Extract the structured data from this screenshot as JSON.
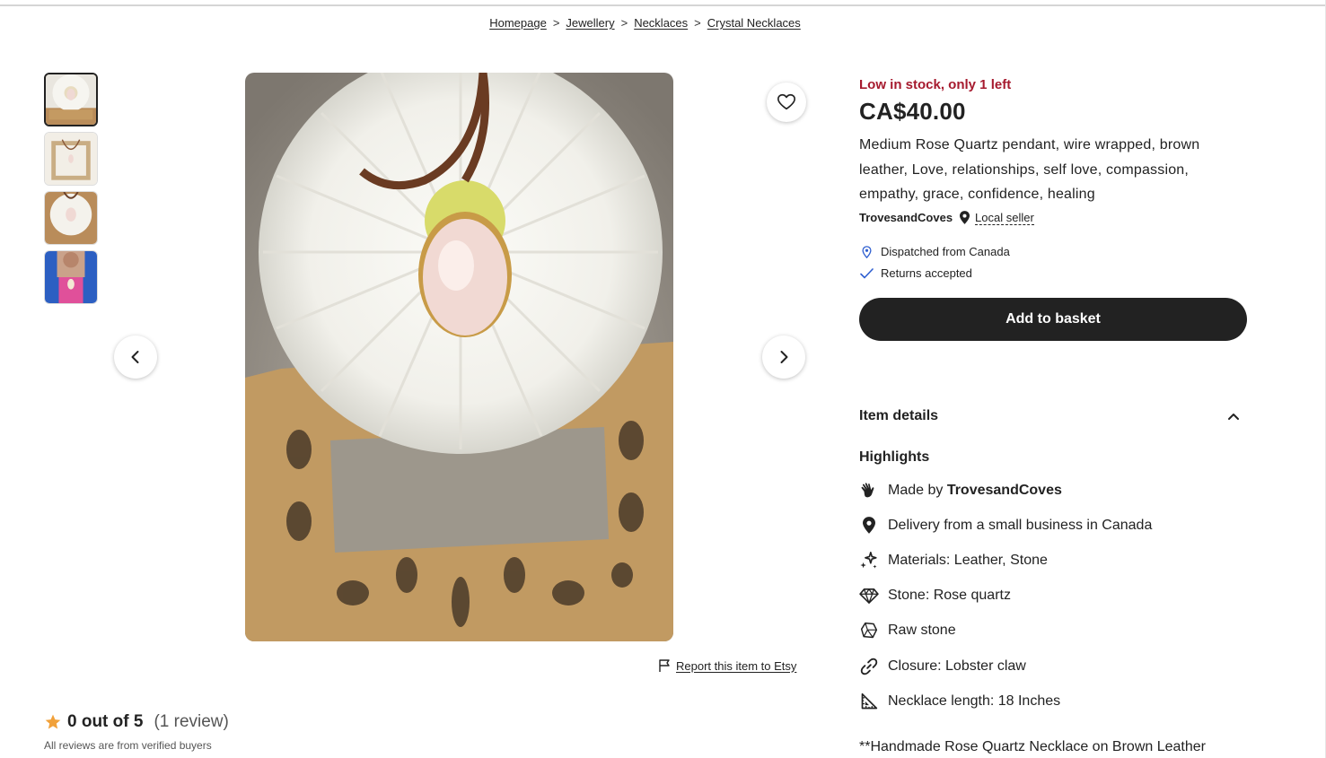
{
  "breadcrumb": {
    "items": [
      "Homepage",
      "Jewellery",
      "Necklaces",
      "Crystal Necklaces"
    ],
    "separator": ">"
  },
  "gallery": {
    "report_label": "Report this item to Etsy",
    "prev_icon": "chevron-left-icon",
    "next_icon": "chevron-right-icon",
    "favorite_icon": "heart-icon"
  },
  "reviews": {
    "score": "0 out of 5",
    "count": "(1 review)",
    "note": "All reviews are from verified buyers"
  },
  "listing": {
    "stock": "Low in stock, only 1 left",
    "price": "CA$40.00",
    "title": "Medium Rose Quartz pendant, wire wrapped, brown leather, Love, relationships, self love, compassion, empathy, grace, confidence, healing",
    "seller": "TrovesandCoves",
    "local_seller": "Local seller",
    "dispatched": "Dispatched from Canada",
    "returns": "Returns accepted",
    "add_to_basket": "Add to basket"
  },
  "details": {
    "heading": "Item details",
    "highlights_heading": "Highlights",
    "made_by_prefix": "Made by ",
    "made_by_name": "TrovesandCoves",
    "delivery": "Delivery from a small business in Canada",
    "materials": "Materials: Leather, Stone",
    "stone": "Stone: Rose quartz",
    "raw": "Raw stone",
    "closure": "Closure: Lobster claw",
    "length": "Necklace length: 18 Inches",
    "description_start": "**Handmade Rose Quartz Necklace on Brown Leather"
  },
  "colors": {
    "stock": "#a61a2e",
    "button": "#222222",
    "star": "#f1a13a",
    "check": "#2f5fd0"
  }
}
